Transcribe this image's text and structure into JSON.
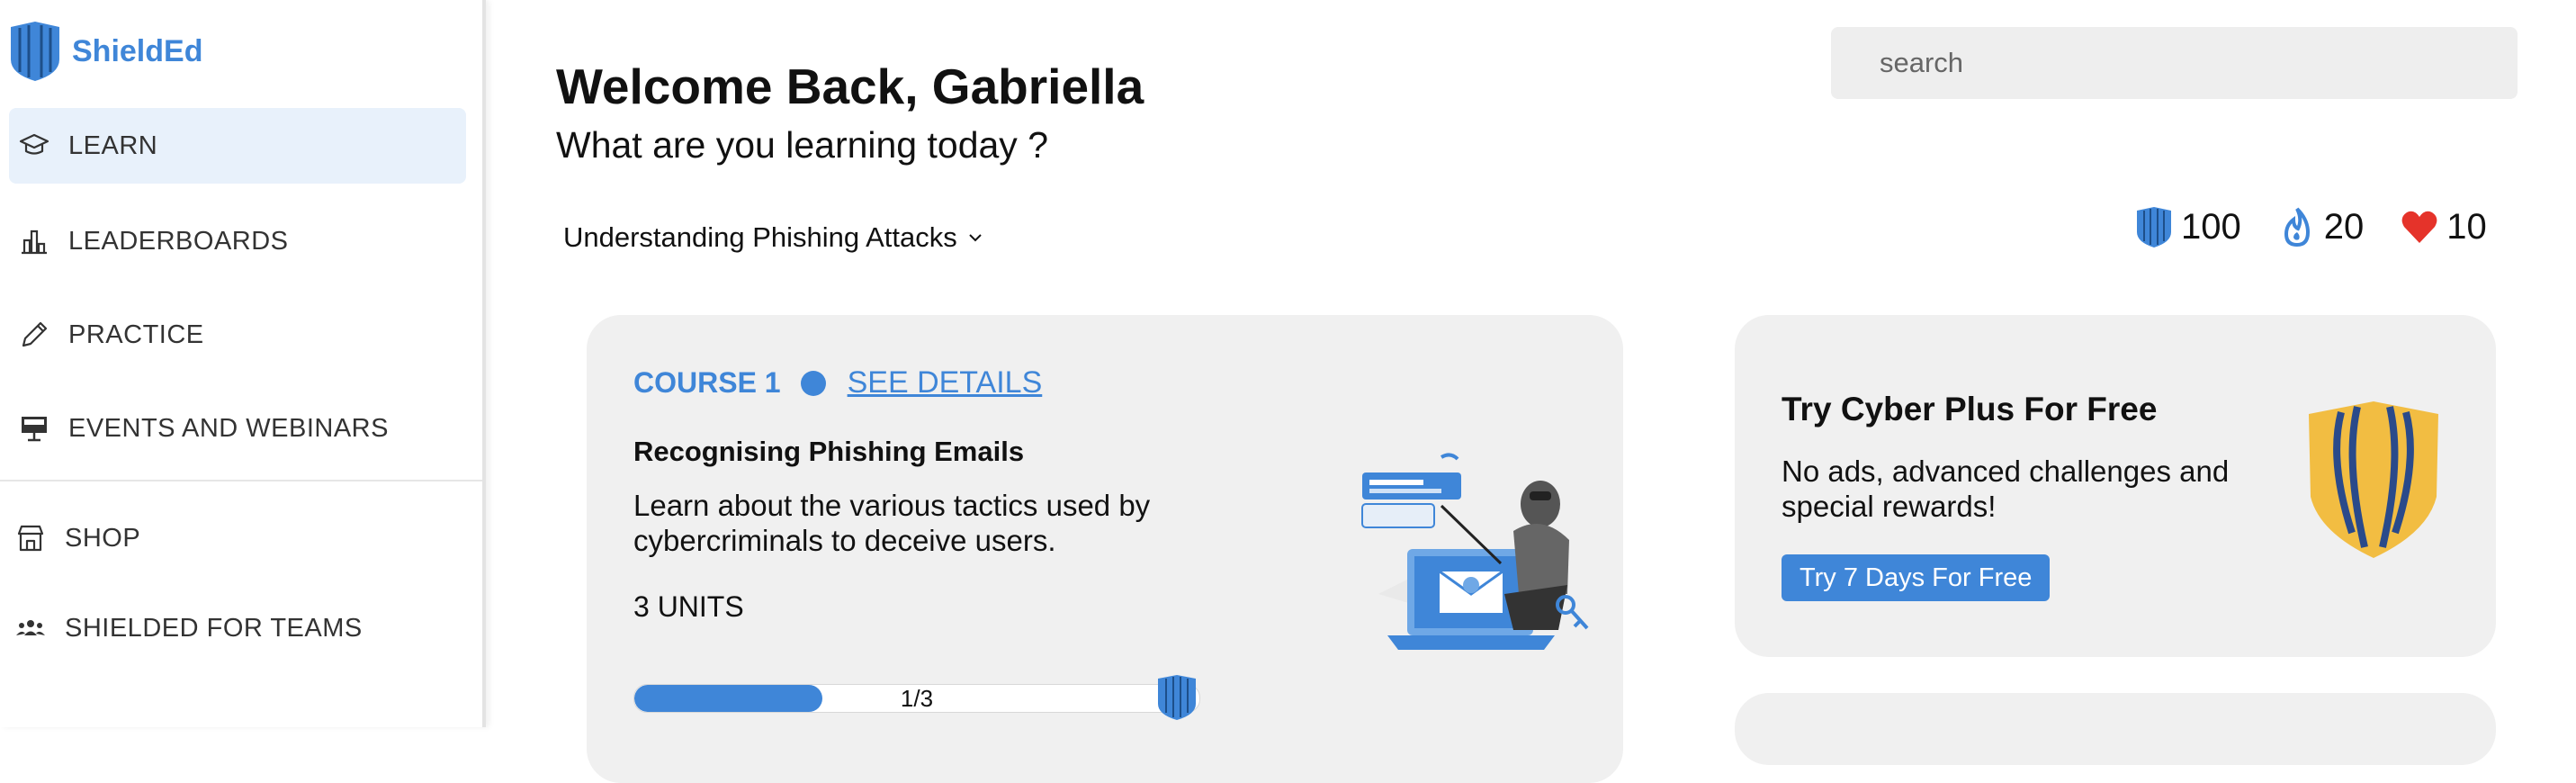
{
  "brand": {
    "name": "ShieldEd",
    "logo_icon": "shield-icon"
  },
  "sidebar": {
    "items": [
      {
        "label": "LEARN",
        "icon": "graduation-cap-icon",
        "active": true
      },
      {
        "label": "LEADERBOARDS",
        "icon": "bar-chart-icon",
        "active": false
      },
      {
        "label": "PRACTICE",
        "icon": "pencil-icon",
        "active": false
      },
      {
        "label": "EVENTS AND WEBINARS",
        "icon": "presentation-board-icon",
        "active": false
      },
      {
        "label": "SHOP",
        "icon": "store-icon",
        "active": false
      },
      {
        "label": "SHIELDED FOR TEAMS",
        "icon": "team-icon",
        "active": false
      }
    ]
  },
  "header": {
    "welcome": "Welcome Back, Gabriella",
    "subtitle": "What are you learning today ?",
    "search_placeholder": "search",
    "course_select": "Understanding Phishing Attacks"
  },
  "stats": {
    "shields": "100",
    "streak": "20",
    "lives": "10"
  },
  "course": {
    "number_label": "COURSE 1",
    "details_link": "SEE DETAILS",
    "title": "Recognising Phishing Emails",
    "description": "Learn about the various tactics used by cybercriminals to deceive users.",
    "units": "3 UNITS",
    "progress_text": "1/3",
    "progress_fraction": 0.333,
    "illustration": "phishing-hacker-illustration"
  },
  "promo": {
    "title": "Try Cyber Plus For Free",
    "description": "No ads, advanced challenges and special rewards!",
    "button": "Try 7 Days For Free",
    "icon": "gold-shield-icon"
  },
  "colors": {
    "accent": "#3f86d8",
    "active_nav_bg": "#e8f1fb",
    "card_bg": "#f0f0f0",
    "gold": "#f2bd42",
    "heart": "#e5332a"
  }
}
